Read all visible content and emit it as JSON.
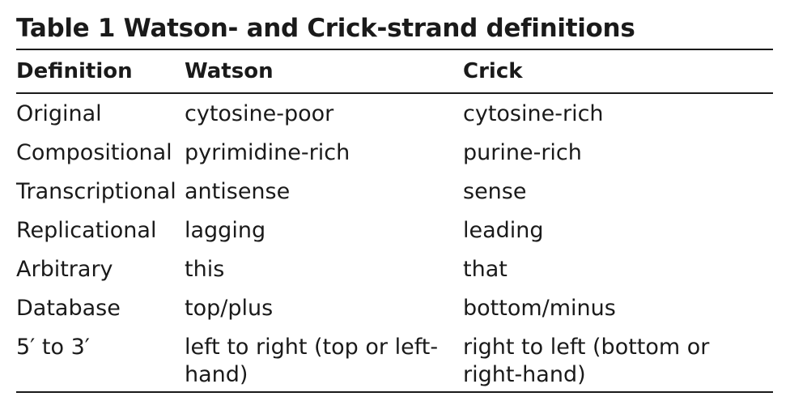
{
  "table": {
    "title": "Table 1 Watson- and Crick-strand definitions",
    "headers": [
      "Definition",
      "Watson",
      "Crick"
    ],
    "rows": [
      [
        "Original",
        "cytosine-poor",
        "cytosine-rich"
      ],
      [
        "Compositional",
        "pyrimidine-rich",
        "purine-rich"
      ],
      [
        "Transcriptional",
        "antisense",
        "sense"
      ],
      [
        "Replicational",
        "lagging",
        "leading"
      ],
      [
        "Arbitrary",
        "this",
        "that"
      ],
      [
        "Database",
        "top/plus",
        "bottom/minus"
      ],
      [
        "5′ to 3′",
        "left to right (top or left-hand)",
        "right to left (bottom or right-hand)"
      ]
    ]
  }
}
